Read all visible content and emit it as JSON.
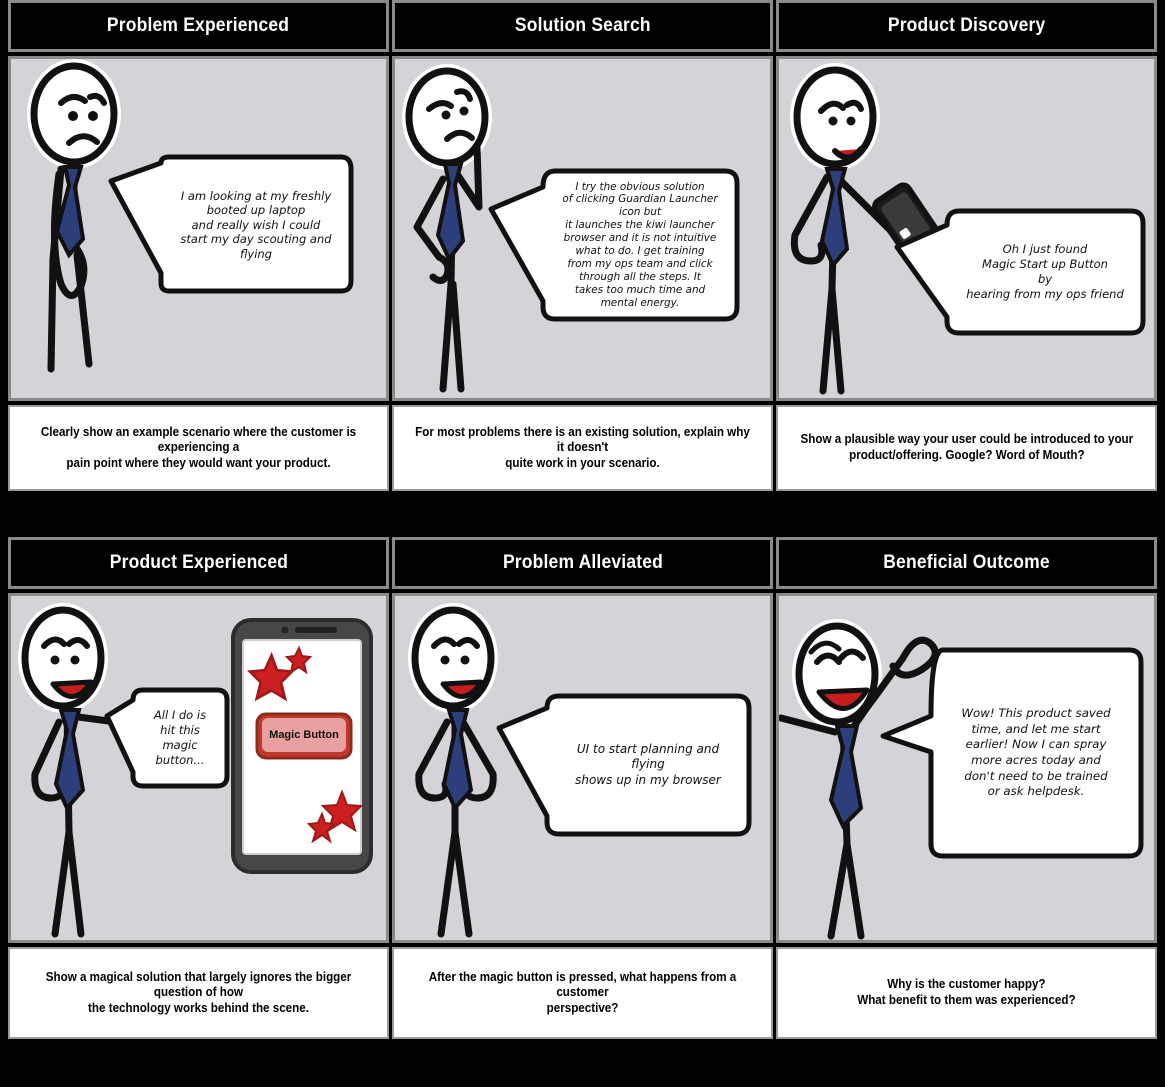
{
  "board": {
    "title": "Customer Journey Storyboard",
    "background_color": "#000000",
    "panel_background": "#d3d3d8",
    "header_background": "#000000",
    "header_text_color": "#ffffff",
    "frame_border_color": "#8a8a8a",
    "tie_color": "#2d3f7a",
    "mouth_color": "#c41e1e",
    "star_color": "#cc1f1f",
    "button_color": "#e8a0a0"
  },
  "panels": [
    {
      "id": "problem-experienced",
      "header": "Problem Experienced",
      "bubble": "I am looking at my freshly\nbooted up laptop\nand really wish I could\nstart my day scouting and\nflying",
      "caption": "Clearly show an example scenario where the customer is experiencing a\npain point where they would want your product.",
      "character": "sad-standing-figure",
      "mood": "sad"
    },
    {
      "id": "solution-search",
      "header": "Solution Search",
      "bubble": "I try the obvious solution\nof clicking Guardian Launcher\nicon but\nit launches the kiwi launcher\nbrowser and it is not intuitive\nwhat to do. I get training\nfrom my ops team and click\nthrough all the steps. It\ntakes too much time and\nmental energy.",
      "caption": "For most problems there is an existing solution, explain why it doesn't\nquite work in your scenario.",
      "character": "thinking-figure",
      "mood": "frustrated"
    },
    {
      "id": "product-discovery",
      "header": "Product Discovery",
      "bubble": "Oh I just found\nMagic Start up Button\nby\nhearing from my ops friend",
      "caption": "Show a plausible way your user could be introduced to your\nproduct/offering. Google? Word of Mouth?",
      "character": "figure-holding-phone",
      "mood": "happy"
    },
    {
      "id": "product-experienced",
      "header": "Product Experienced",
      "bubble": "All I do is\nhit this\nmagic\nbutton...",
      "caption": "Show a magical solution that largely ignores the bigger question of how\nthe technology works behind the scene.",
      "character": "figure-presenting-phone",
      "mood": "excited",
      "device": {
        "button_label": "Magic Button",
        "stars": 4
      }
    },
    {
      "id": "problem-alleviated",
      "header": "Problem Alleviated",
      "bubble": "UI to start planning and\nflying\nshows up in my browser",
      "caption": "After the magic button is pressed, what happens from a customer\nperspective?",
      "character": "happy-hands-on-hips-figure",
      "mood": "happy"
    },
    {
      "id": "beneficial-outcome",
      "header": "Beneficial Outcome",
      "bubble": "Wow! This product saved\ntime, and let me start\nearlier! Now I can spray\nmore acres today and\ndon't need to be trained\nor ask helpdesk.",
      "caption": "Why is the customer happy?\nWhat benefit to them was experienced?",
      "character": "cheering-figure",
      "mood": "delighted"
    }
  ]
}
